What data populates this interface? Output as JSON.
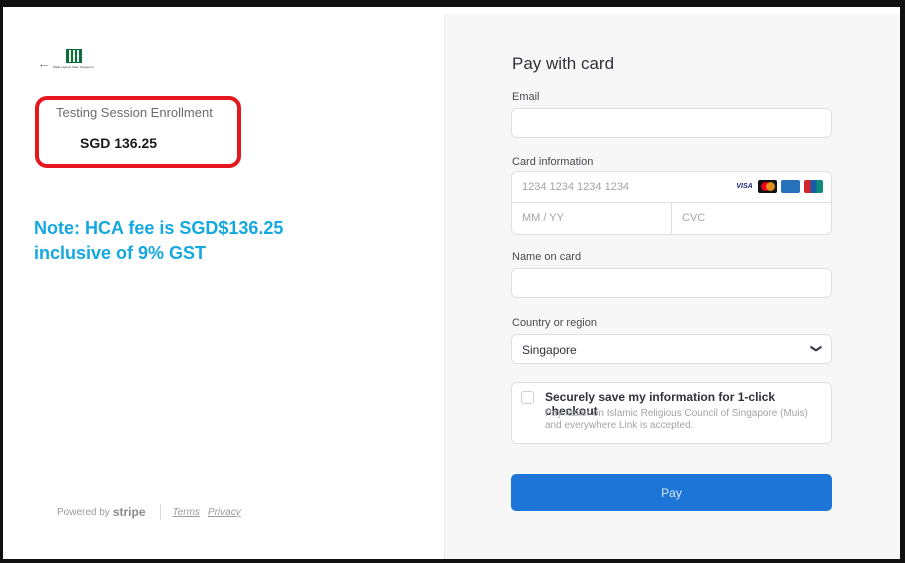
{
  "left": {
    "back_icon": "arrow-left-icon",
    "logo_text": "Majlis Ugama Islam Singapura",
    "product_name": "Testing Session Enrollment",
    "price": "SGD 136.25",
    "note_line1": "Note: HCA fee is SGD$136.25",
    "note_line2": "inclusive of 9% GST",
    "highlight_color": "#e41920",
    "note_color": "#14a8e1",
    "footer": {
      "powered_by": "Powered by",
      "stripe": "stripe",
      "terms": "Terms",
      "privacy": "Privacy"
    }
  },
  "form": {
    "title": "Pay with card",
    "email_label": "Email",
    "email_value": "",
    "card_label": "Card information",
    "card_number_placeholder": "1234 1234 1234 1234",
    "expiry_placeholder": "MM / YY",
    "cvc_placeholder": "CVC",
    "card_brands": [
      "visa",
      "mastercard",
      "amex",
      "unionpay"
    ],
    "visa_text": "VISA",
    "name_label": "Name on card",
    "name_value": "",
    "country_label": "Country or region",
    "country_value": "Singapore",
    "save_checked": false,
    "save_title": "Securely save my information for 1-click checkout",
    "save_desc": "Pay faster on Islamic Religious Council of Singapore (Muis) and everywhere Link is accepted.",
    "pay_label": "Pay",
    "accent_color": "#1d75d8"
  }
}
